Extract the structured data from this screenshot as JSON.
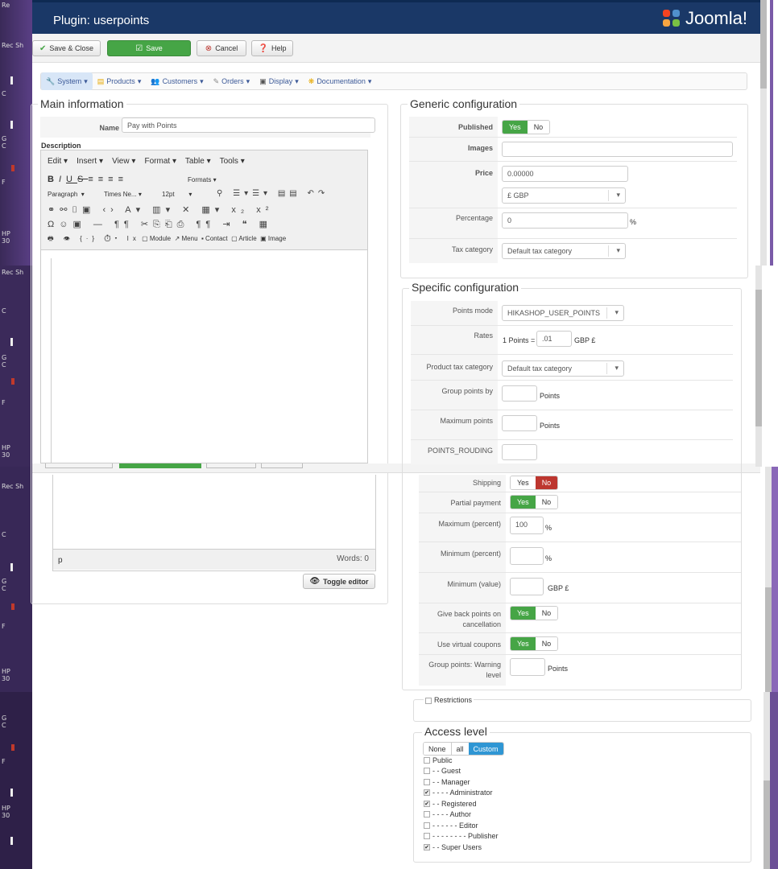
{
  "header": {
    "title": "Plugin: userpoints",
    "brand": "Joomla!"
  },
  "toolbar": {
    "save_close": "Save & Close",
    "save": "Save",
    "cancel": "Cancel",
    "help": "Help"
  },
  "menu": [
    "System",
    "Products",
    "Customers",
    "Orders",
    "Display",
    "Documentation"
  ],
  "main_info": {
    "legend": "Main information",
    "name_label": "Name",
    "name_value": "Pay with Points",
    "description_label": "Description",
    "editor_menu": [
      "Edit",
      "Insert",
      "View",
      "Format",
      "Table",
      "Tools"
    ],
    "formats": "Formats",
    "paragraph": "Paragraph",
    "font_family": "Times Ne...",
    "font_size": "12pt",
    "btn_module": "Module",
    "btn_menu": "Menu",
    "btn_contact": "Contact",
    "btn_article": "Article",
    "btn_image": "Image",
    "status_path": "p",
    "words": "Words: 0",
    "toggle_editor": "Toggle editor"
  },
  "generic": {
    "legend": "Generic configuration",
    "published_label": "Published",
    "yes": "Yes",
    "no": "No",
    "images_label": "Images",
    "price_label": "Price",
    "price_value": "0.00000",
    "currency": "£ GBP",
    "percentage_label": "Percentage",
    "percentage_value": "0",
    "percent_sign": "%",
    "tax_label": "Tax category",
    "tax_value": "Default tax category"
  },
  "specific": {
    "legend": "Specific configuration",
    "points_mode_label": "Points mode",
    "points_mode_value": "HIKASHOP_USER_POINTS",
    "rates_label": "Rates",
    "rates_prefix": "1 Points =",
    "rates_value": ".01",
    "rates_suffix": "GBP £",
    "product_tax_label": "Product tax category",
    "product_tax_value": "Default tax category",
    "group_points_label": "Group points by",
    "points_word": "Points",
    "max_points_label": "Maximum points",
    "rouding_label": "POINTS_ROUDING",
    "shipping_label": "Shipping",
    "partial_label": "Partial payment",
    "max_percent_label": "Maximum (percent)",
    "max_percent_value": "100",
    "min_percent_label": "Minimum (percent)",
    "min_value_label": "Minimum (value)",
    "gbp": "GBP £",
    "give_back_label": "Give back points on cancellation",
    "virtual_label": "Use virtual coupons",
    "warning_label": "Group points: Warning level"
  },
  "restrictions": "Restrictions",
  "access": {
    "legend": "Access level",
    "modes": [
      "None",
      "all",
      "Custom"
    ],
    "levels": [
      {
        "label": "Public",
        "checked": false
      },
      {
        "label": "- - Guest",
        "checked": false
      },
      {
        "label": "- - Manager",
        "checked": false
      },
      {
        "label": "- - - - Administrator",
        "checked": true
      },
      {
        "label": "- - Registered",
        "checked": true
      },
      {
        "label": "- - - - Author",
        "checked": false
      },
      {
        "label": "- - - - - - Editor",
        "checked": false
      },
      {
        "label": "- - - - - - - - Publisher",
        "checked": false
      },
      {
        "label": "- - Super Users",
        "checked": true
      }
    ]
  },
  "desktop_labels": [
    "Re",
    "Rec Sh",
    "C",
    "G C",
    "F",
    "HP 30"
  ],
  "colors": {
    "header": "#1a3867",
    "green": "#46a546",
    "red": "#bd362f",
    "blue": "#2f96d4"
  }
}
